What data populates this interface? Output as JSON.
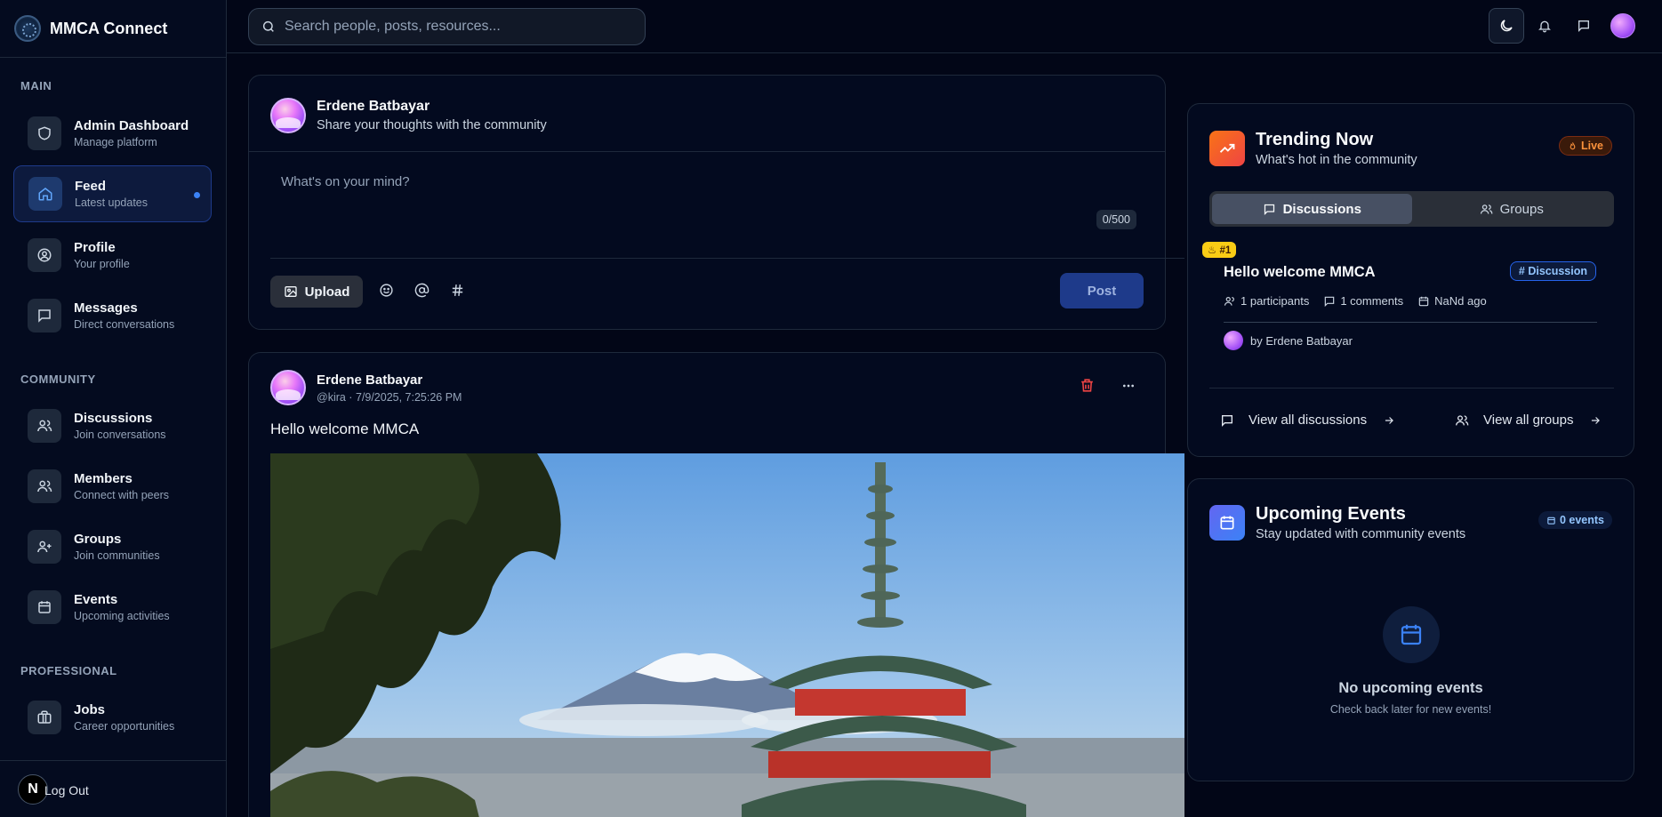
{
  "brand": {
    "name": "MMCA Connect"
  },
  "sidebar": {
    "sections": [
      {
        "label": "MAIN"
      },
      {
        "label": "COMMUNITY"
      },
      {
        "label": "PROFESSIONAL"
      }
    ],
    "items": [
      {
        "title": "Admin Dashboard",
        "subtitle": "Manage platform",
        "icon": "shield-icon"
      },
      {
        "title": "Feed",
        "subtitle": "Latest updates",
        "icon": "home-icon",
        "active": true
      },
      {
        "title": "Profile",
        "subtitle": "Your profile",
        "icon": "user-circle-icon"
      },
      {
        "title": "Messages",
        "subtitle": "Direct conversations",
        "icon": "message-icon"
      },
      {
        "title": "Discussions",
        "subtitle": "Join conversations",
        "icon": "users-icon"
      },
      {
        "title": "Members",
        "subtitle": "Connect with peers",
        "icon": "users-icon"
      },
      {
        "title": "Groups",
        "subtitle": "Join communities",
        "icon": "user-plus-icon"
      },
      {
        "title": "Events",
        "subtitle": "Upcoming activities",
        "icon": "calendar-icon"
      },
      {
        "title": "Jobs",
        "subtitle": "Career opportunities",
        "icon": "briefcase-icon"
      }
    ],
    "footer": {
      "badge": "N",
      "logout_label": "Log Out"
    }
  },
  "topbar": {
    "search_placeholder": "Search people, posts, resources..."
  },
  "composer": {
    "user_name": "Erdene Batbayar",
    "subtitle": "Share your thoughts with the community",
    "placeholder": "What's on your mind?",
    "char_count": "0/500",
    "upload_label": "Upload",
    "post_label": "Post"
  },
  "post": {
    "author": "Erdene Batbayar",
    "meta": "@kira · 7/9/2025, 7:25:26 PM",
    "text": "Hello welcome MMCA"
  },
  "trending": {
    "title": "Trending Now",
    "subtitle": "What's hot in the community",
    "live_label": "Live",
    "tabs": [
      {
        "label": "Discussions",
        "active": true
      },
      {
        "label": "Groups",
        "active": false
      }
    ],
    "item": {
      "rank": "#1",
      "title": "Hello welcome MMCA",
      "badge": "Discussion",
      "participants": "1 participants",
      "comments": "1 comments",
      "time": "NaNd ago",
      "author": "by Erdene Batbayar"
    },
    "view_discussions": "View all discussions",
    "view_groups": "View all groups"
  },
  "events": {
    "title": "Upcoming Events",
    "subtitle": "Stay updated with community events",
    "count_label": "0 events",
    "empty_title": "No upcoming events",
    "empty_sub": "Check back later for new events!"
  },
  "colors": {
    "accent": "#3b82f6",
    "trending_icon": "#f97316",
    "events_icon": "#6366f1",
    "danger": "#ef4444"
  }
}
